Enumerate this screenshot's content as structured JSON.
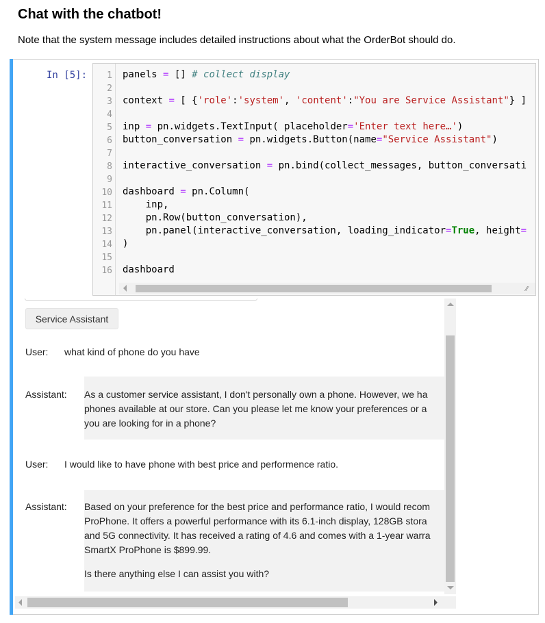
{
  "page": {
    "heading": "Chat with the chatbot!",
    "note": "Note that the system message includes detailed instructions about what the OrderBot should do."
  },
  "cell": {
    "prompt": "In [5]:",
    "line_numbers": [
      "1",
      "2",
      "3",
      "4",
      "5",
      "6",
      "7",
      "8",
      "9",
      "10",
      "11",
      "12",
      "13",
      "14",
      "15",
      "16"
    ],
    "code_lines": [
      "panels = [] # collect display",
      "",
      "context = [ {'role':'system', 'content':\"You are Service Assistant\"} ]",
      "",
      "inp = pn.widgets.TextInput( placeholder='Enter text here…')",
      "button_conversation = pn.widgets.Button(name=\"Service Assistant\")",
      "",
      "interactive_conversation = pn.bind(collect_messages, button_conversati",
      "",
      "dashboard = pn.Column(",
      "    inp,",
      "    pn.Row(button_conversation),",
      "    pn.panel(interactive_conversation, loading_indicator=True, height=",
      ")",
      "",
      "dashboard"
    ]
  },
  "output": {
    "button_label": "Service Assistant",
    "user_label": "User:",
    "assistant_label": "Assistant:",
    "user_msg_1": "what kind of phone do you have",
    "assistant_msg_1": [
      "As a customer service assistant, I don't personally own a phone. However, we ha",
      "phones available at our store. Can you please let me know your preferences or a",
      "you are looking for in a phone?"
    ],
    "user_msg_2": "I would like to have phone with best price and performence ratio.",
    "assistant_msg_2": [
      "Based on your preference for the best price and performance ratio, I would recom",
      "ProPhone. It offers a powerful performance with its 6.1-inch display, 128GB stora",
      "and 5G connectivity. It has received a rating of 4.6 and comes with a 1-year warra",
      "SmartX ProPhone is $899.99."
    ],
    "assistant_msg_2_followup": "Is there anything else I can assist you with?"
  },
  "colors": {
    "cell_accent": "#42a5f5",
    "prompt": "#303f9f",
    "assistant_bg": "#f2f2f2"
  }
}
